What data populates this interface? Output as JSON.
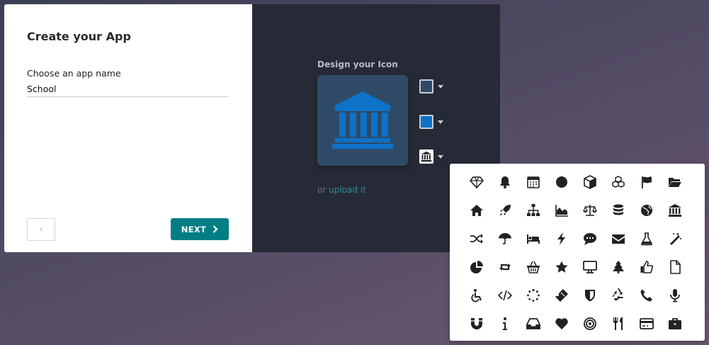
{
  "dialog": {
    "title": "Create your App",
    "app_name_label": "Choose an app name",
    "app_name_value": "School",
    "prev_symbol": "‹",
    "next_label": "NEXT"
  },
  "icon_designer": {
    "label": "Design your Icon",
    "background_color": "#2e4a66",
    "icon_color": "#0d72c8",
    "selected_icon": "bank-icon",
    "upload_prefix": "or ",
    "upload_link": "upload it"
  },
  "icon_picker": {
    "icons": [
      "diamond-icon",
      "bell-icon",
      "calendar-icon",
      "circle-icon",
      "cube-icon",
      "cubes-icon",
      "flag-icon",
      "folder-open-icon",
      "home-icon",
      "rocket-icon",
      "sitemap-icon",
      "area-chart-icon",
      "balance-scale-icon",
      "database-icon",
      "globe-icon",
      "bank-icon",
      "random-icon",
      "umbrella-icon",
      "bed-icon",
      "bolt-icon",
      "comment-icon",
      "envelope-icon",
      "flask-icon",
      "magic-icon",
      "pie-chart-icon",
      "retweet-icon",
      "shopping-basket-icon",
      "star-icon",
      "desktop-icon",
      "tree-icon",
      "thumbs-up-icon",
      "file-icon",
      "wheelchair-icon",
      "code-icon",
      "spinner-icon",
      "ticket-icon",
      "shield-icon",
      "recycle-icon",
      "phone-icon",
      "microphone-icon",
      "magnet-icon",
      "info-icon",
      "inbox-icon",
      "heart-icon",
      "bullseye-icon",
      "cutlery-icon",
      "credit-card-icon",
      "suitcase-icon"
    ]
  }
}
